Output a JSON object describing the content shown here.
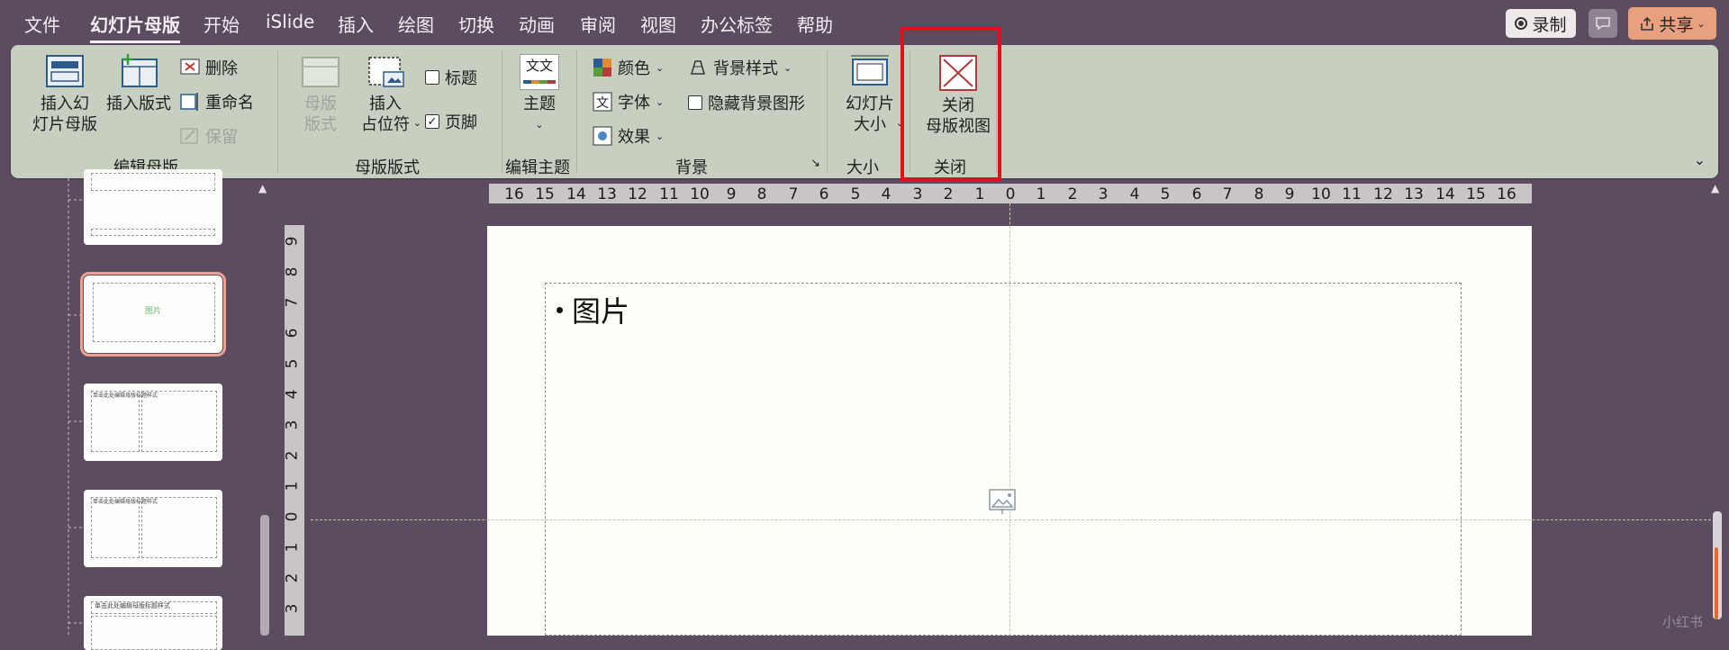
{
  "menubar": {
    "items": [
      "文件",
      "幻灯片母版",
      "开始",
      "iSlide",
      "插入",
      "绘图",
      "切换",
      "动画",
      "审阅",
      "视图",
      "办公标签",
      "帮助"
    ],
    "active_index": 1,
    "record_label": "录制",
    "share_label": "共享"
  },
  "ribbon": {
    "edit_master": {
      "group_label": "编辑母版",
      "insert_master": "插入幻\n灯片母版",
      "insert_layout": "插入版式",
      "delete": "删除",
      "rename": "重命名",
      "preserve": "保留"
    },
    "master_layout": {
      "group_label": "母版版式",
      "master_layout_btn": "母版\n版式",
      "insert_placeholder": "插入\n占位符",
      "title_chk": "标题",
      "footer_chk": "页脚",
      "title_checked": false,
      "footer_checked": true
    },
    "edit_theme": {
      "group_label": "编辑主题",
      "theme_btn": "主题",
      "theme_icon_text": "文文"
    },
    "background": {
      "group_label": "背景",
      "colors": "颜色",
      "fonts": "字体",
      "effects": "效果",
      "bg_styles": "背景样式",
      "hide_bg": "隐藏背景图形",
      "hide_bg_checked": false
    },
    "size": {
      "group_label": "大小",
      "slide_size": "幻灯片\n大小"
    },
    "close": {
      "group_label": "关闭",
      "close_view": "关闭\n母版视图"
    }
  },
  "rulers": {
    "horizontal": [
      "16",
      "15",
      "14",
      "13",
      "12",
      "11",
      "10",
      "9",
      "8",
      "7",
      "6",
      "5",
      "4",
      "3",
      "2",
      "1",
      "0",
      "1",
      "2",
      "3",
      "4",
      "5",
      "6",
      "7",
      "8",
      "9",
      "10",
      "11",
      "12",
      "13",
      "14",
      "15",
      "16"
    ],
    "vertical": [
      "9",
      "8",
      "7",
      "6",
      "5",
      "4",
      "3",
      "2",
      "1",
      "0",
      "1",
      "2",
      "3"
    ]
  },
  "slide": {
    "bullet": "图片"
  },
  "thumbnails": [
    {
      "label": ""
    },
    {
      "label": "图片"
    },
    {
      "label": "单击此处编辑母版标题样式"
    },
    {
      "label": "单击此处编辑母版标题样式"
    },
    {
      "label": "单击此处编辑母版标题样式"
    }
  ],
  "watermark": "小红书",
  "colors": {
    "accent_highlight": "#e0101a",
    "ribbon_bg": "#c6cfc0",
    "chrome_bg": "#5b4c5f",
    "share_btn": "#e9a07f",
    "selected_thumb": "#f0a08f"
  }
}
